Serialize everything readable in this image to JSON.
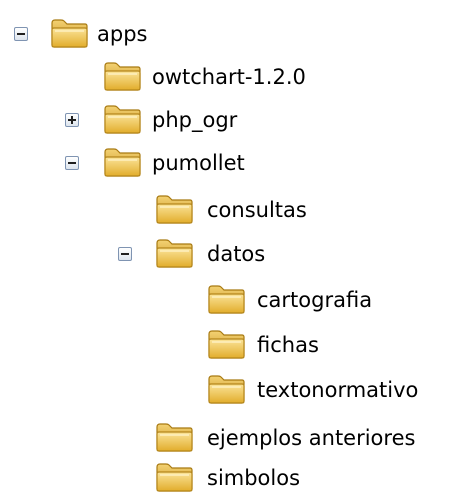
{
  "tree": {
    "items": [
      {
        "label": "apps",
        "toggle": "collapse"
      },
      {
        "label": "owtchart-1.2.0"
      },
      {
        "label": "php_ogr",
        "toggle": "expand"
      },
      {
        "label": "pumollet",
        "toggle": "collapse"
      },
      {
        "label": "consultas"
      },
      {
        "label": "datos",
        "toggle": "collapse"
      },
      {
        "label": "cartografia"
      },
      {
        "label": "fichas"
      },
      {
        "label": "textonormativo"
      },
      {
        "label": "ejemplos anteriores"
      },
      {
        "label": "simbolos"
      }
    ]
  },
  "colors": {
    "folder_body": "#f0c84a",
    "folder_dark": "#c99a22",
    "toggle_border": "#7f94b2",
    "text": "#000000"
  }
}
